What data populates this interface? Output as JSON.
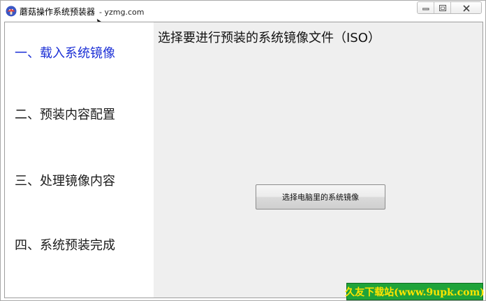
{
  "window": {
    "title": "蘑菇操作系统预装器",
    "subtitle": "- yzmg.com"
  },
  "sidebar": {
    "steps": [
      {
        "label": "一、载入系统镜像",
        "active": true
      },
      {
        "label": "二、预装内容配置",
        "active": false
      },
      {
        "label": "三、处理镜像内容",
        "active": false
      },
      {
        "label": "四、系统预装完成",
        "active": false
      }
    ]
  },
  "main": {
    "heading": "选择要进行预装的系统镜像文件（ISO）",
    "select_button_label": "选择电脑里的系统镜像"
  },
  "watermark": {
    "text": "久友下载站(www.9upk.com)"
  },
  "colors": {
    "active_step": "#1b2fd6",
    "main_background": "#efefef",
    "watermark_bg": "#1fa33a",
    "watermark_text": "#ffe400"
  },
  "icons": {
    "app": "mushroom-logo-icon",
    "minimize": "minimize-icon",
    "maximize": "maximize-icon",
    "close": "close-icon",
    "cursor": "mouse-cursor-icon"
  }
}
